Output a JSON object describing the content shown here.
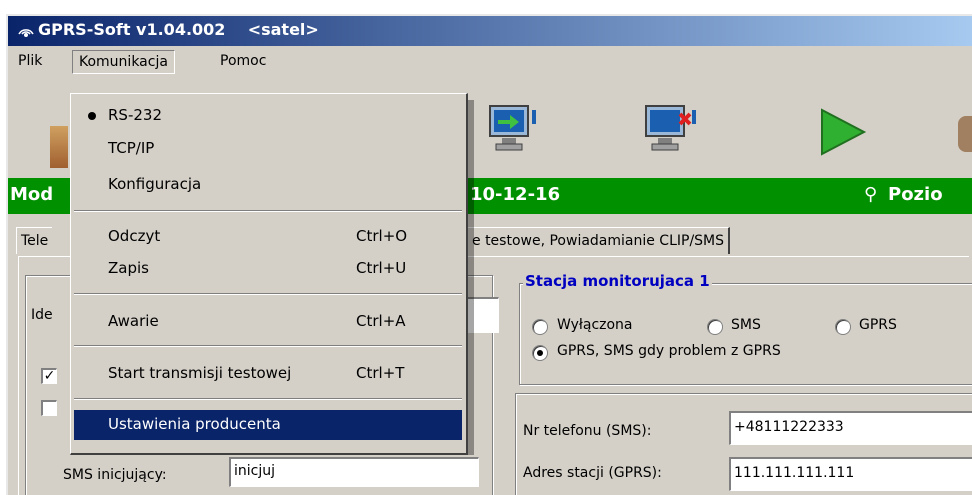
{
  "window": {
    "title": "GPRS-Soft v1.04.002",
    "subtitle": "<satel>"
  },
  "menubar": [
    {
      "label": "Plik"
    },
    {
      "label": "Komunikacja"
    },
    {
      "label": "Pomoc"
    }
  ],
  "status": {
    "left": "Mod",
    "date": "10-12-16",
    "right": "Pozio"
  },
  "tabs": [
    {
      "label": "Tele"
    },
    {
      "label": "e testowe, Powiadamianie CLIP/SMS"
    }
  ],
  "dropdown": {
    "items": [
      {
        "label": "RS-232",
        "shortcut": "",
        "bullet": true
      },
      {
        "label": "TCP/IP",
        "shortcut": ""
      },
      {
        "label": "Konfiguracja",
        "shortcut": ""
      },
      {
        "label": "Odczyt",
        "shortcut": "Ctrl+O"
      },
      {
        "label": "Zapis",
        "shortcut": "Ctrl+U"
      },
      {
        "label": "Awarie",
        "shortcut": "Ctrl+A"
      },
      {
        "label": "Start transmisji testowej",
        "shortcut": "Ctrl+T"
      },
      {
        "label": "Ustawienia producenta",
        "shortcut": "",
        "highlighted": true
      }
    ]
  },
  "left_panel": {
    "id_label": "Ide",
    "checkbox1_checked": true,
    "checkbox2_checked": false,
    "sms_label": "SMS inicjujący:",
    "sms_value": "inicjuj"
  },
  "station": {
    "title": "Stacja monitorujaca 1",
    "radio_off": "Wyłączona",
    "radio_sms": "SMS",
    "radio_gprs": "GPRS",
    "radio_gprs_sms": "GPRS, SMS gdy problem z GPRS",
    "selected": "GPRS, SMS gdy problem z GPRS",
    "phone_label": "Nr telefonu (SMS):",
    "phone_value": "+48111222333",
    "addr_label": "Adres stacji (GPRS):",
    "addr_value": "111.111.111.111"
  },
  "colors": {
    "status_bg": "#009000",
    "menu_highlight": "#0a246a",
    "group_title": "#0000c0"
  }
}
